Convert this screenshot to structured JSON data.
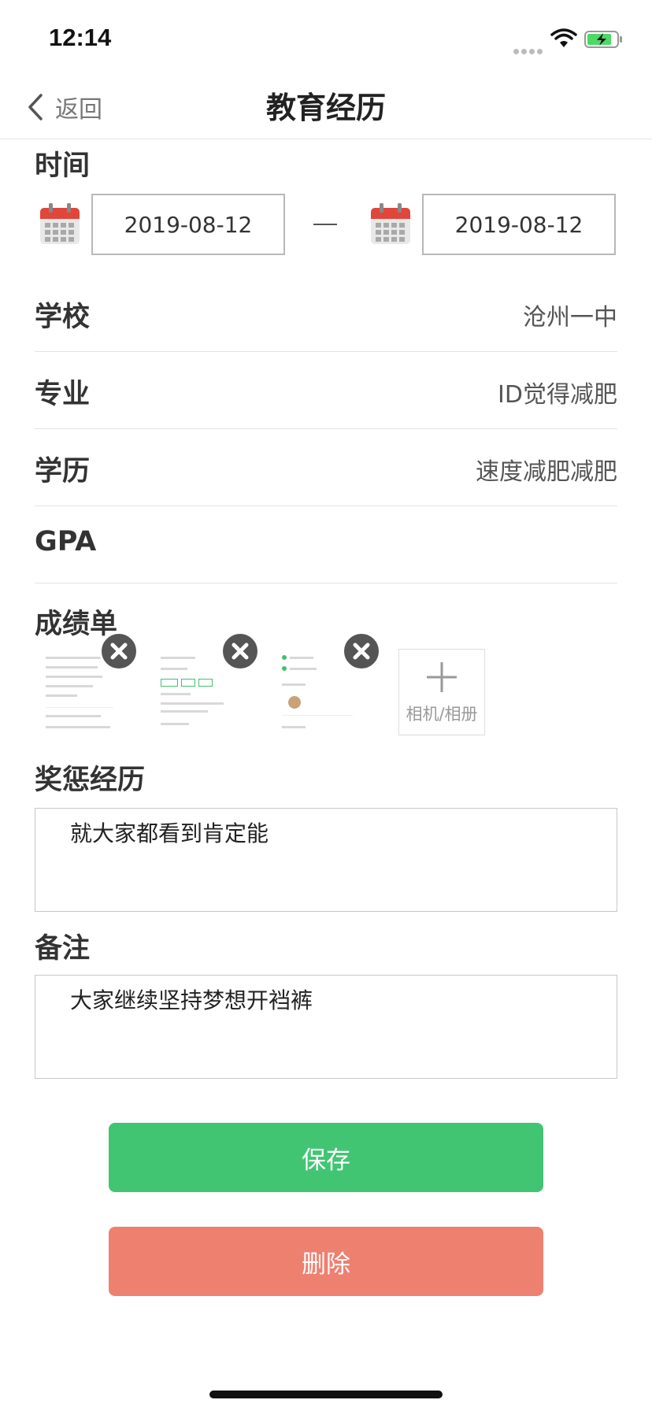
{
  "status_bar": {
    "time": "12:14"
  },
  "nav": {
    "back_label": "返回",
    "title": "教育经历"
  },
  "time_section": {
    "label": "时间",
    "start_date": "2019-08-12",
    "end_date": "2019-08-12"
  },
  "fields": [
    {
      "label": "学校",
      "value": "沧州一中"
    },
    {
      "label": "专业",
      "value": "ID觉得减肥"
    },
    {
      "label": "学历",
      "value": "速度减肥减肥"
    },
    {
      "label": "GPA",
      "value": ""
    }
  ],
  "transcript": {
    "label": "成绩单",
    "add_label": "相机/相册"
  },
  "awards": {
    "label": "奖惩经历",
    "text": "就大家都看到肯定能"
  },
  "notes": {
    "label": "备注",
    "text": "大家继续坚持梦想开裆裤"
  },
  "actions": {
    "save_label": "保存",
    "delete_label": "删除"
  },
  "colors": {
    "save": "#42c573",
    "delete": "#ee8070",
    "calendar_red": "#e0463a"
  },
  "icons": [
    "calendar-icon",
    "remove-icon",
    "plus-icon",
    "back-chevron-icon",
    "wifi-icon",
    "battery-icon"
  ]
}
